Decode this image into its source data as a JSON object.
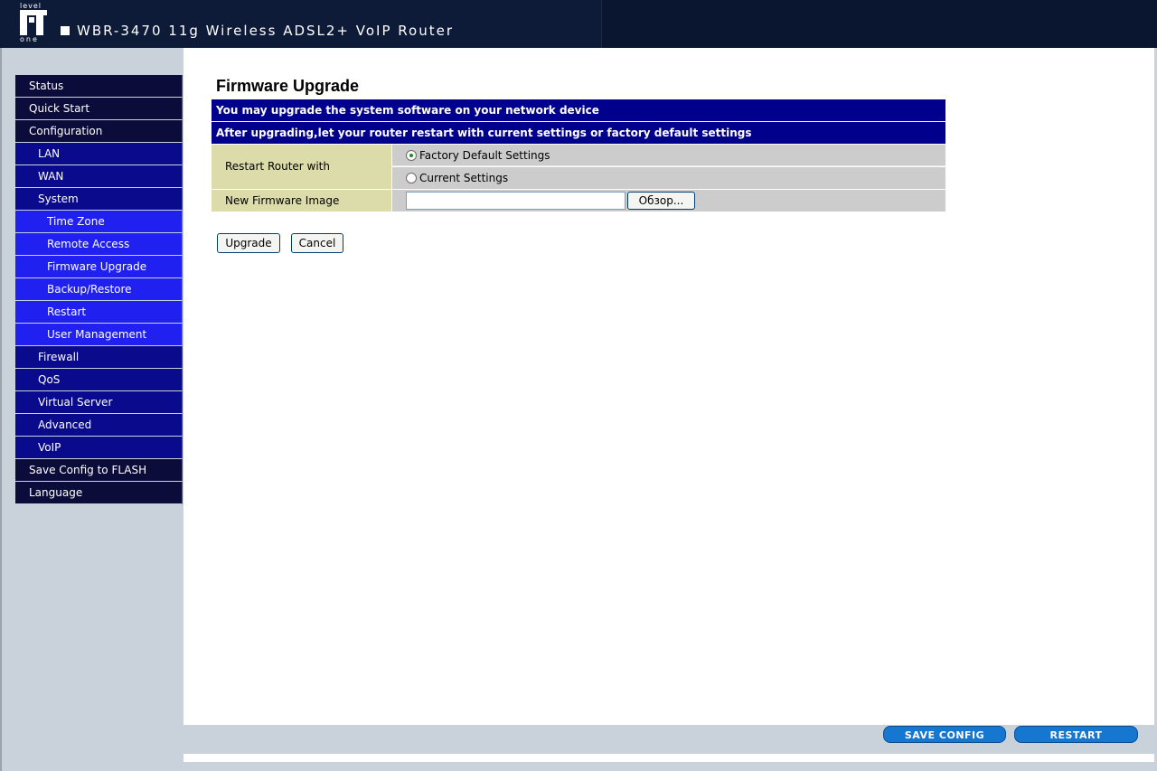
{
  "header": {
    "logo_top": "level",
    "logo_bottom": "one",
    "product_title": "WBR-3470 11g Wireless ADSL2+ VoIP Router"
  },
  "sidebar": {
    "items": [
      {
        "label": "Status",
        "level": 1
      },
      {
        "label": "Quick Start",
        "level": 1
      },
      {
        "label": "Configuration",
        "level": 1
      },
      {
        "label": "LAN",
        "level": 2
      },
      {
        "label": "WAN",
        "level": 2
      },
      {
        "label": "System",
        "level": 2
      },
      {
        "label": "Time Zone",
        "level": 3
      },
      {
        "label": "Remote Access",
        "level": 3
      },
      {
        "label": "Firmware Upgrade",
        "level": 3
      },
      {
        "label": "Backup/Restore",
        "level": 3
      },
      {
        "label": "Restart",
        "level": 3
      },
      {
        "label": "User Management",
        "level": 3
      },
      {
        "label": "Firewall",
        "level": 2
      },
      {
        "label": "QoS",
        "level": 2
      },
      {
        "label": "Virtual Server",
        "level": 2
      },
      {
        "label": "Advanced",
        "level": 2
      },
      {
        "label": "VoIP",
        "level": 2
      },
      {
        "label": "Save Config to FLASH",
        "level": 1
      },
      {
        "label": "Language",
        "level": 1
      }
    ]
  },
  "main": {
    "title": "Firmware Upgrade",
    "banner1": "You may upgrade the system software on your network device",
    "banner2": "After upgrading,let your router restart with current settings or factory default settings",
    "restart_label": "Restart Router with",
    "option_factory": "Factory Default Settings",
    "option_current": "Current Settings",
    "selected_option": "Factory Default Settings",
    "image_label": "New Firmware Image",
    "file_value": "",
    "browse_label": "Обзор...",
    "upgrade_label": "Upgrade",
    "cancel_label": "Cancel"
  },
  "footer": {
    "save_config_label": "SAVE CONFIG",
    "restart_label": "RESTART"
  },
  "colors": {
    "header_bg": "#0d1a38",
    "menu_level1": "#0c0c3a",
    "menu_level2": "#0a0a8c",
    "menu_level3": "#2020f0",
    "banner_bg": "#00008c",
    "label_bg": "#dcdcaa",
    "value_bg": "#cccccc",
    "pill_bg": "#1577d0"
  }
}
